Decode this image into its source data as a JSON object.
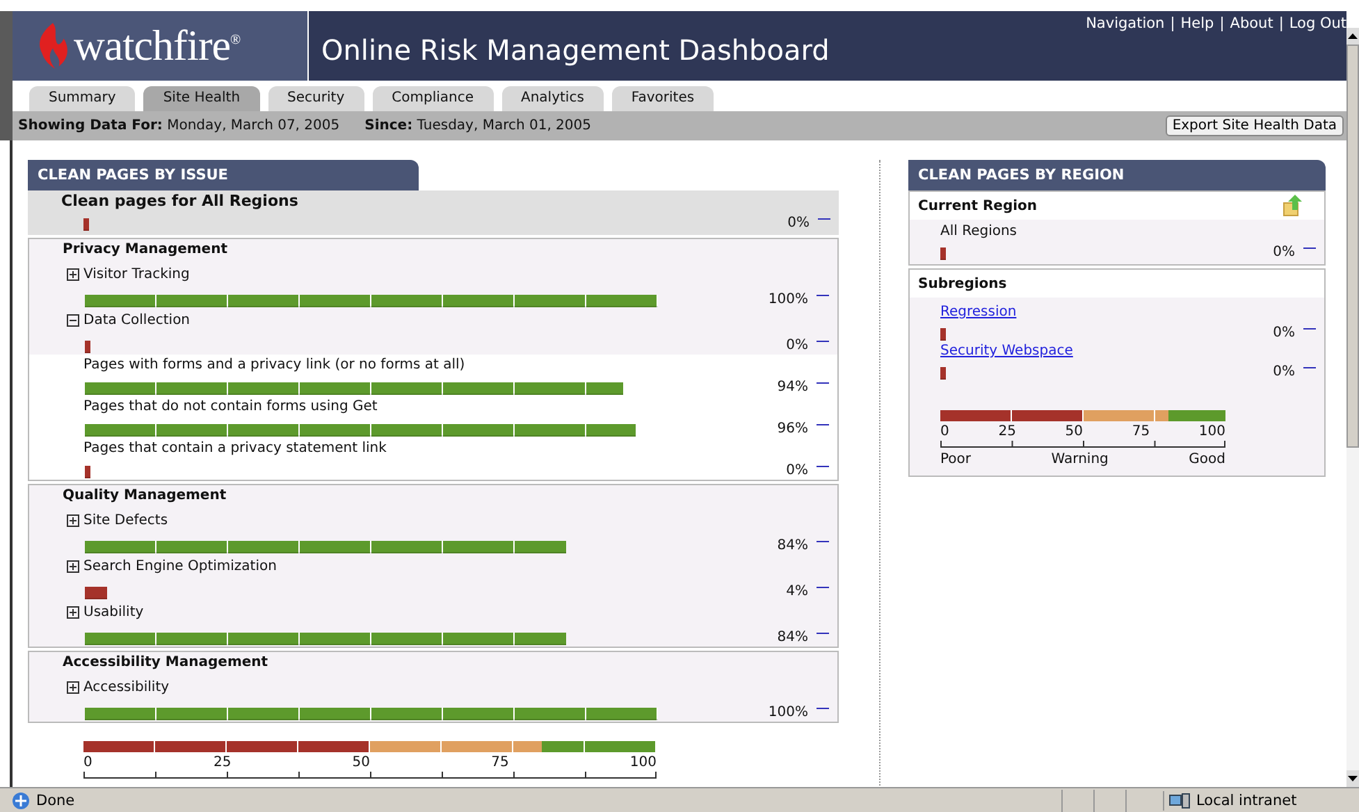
{
  "header": {
    "logo": "watchfire$^{®}$",
    "title": "Online Risk Management Dashboard",
    "links": [
      "Navigation",
      "Help",
      "About",
      "Log Out"
    ],
    "separator": "|"
  },
  "tabs": [
    {
      "label": "Summary",
      "selected": false
    },
    {
      "label": "Site Health",
      "selected": true
    },
    {
      "label": "Security",
      "selected": false
    },
    {
      "label": "Compliance",
      "selected": false
    },
    {
      "label": "Analytics",
      "selected": false
    },
    {
      "label": "Favorites",
      "selected": false
    }
  ],
  "info_bar": {
    "showing_label": "Showing Data For:",
    "showing_value": "Monday, March 07, 2005",
    "since_label": "Since:",
    "since_value": "Tuesday, March 01, 2005",
    "export_button": "Export Site Health Data"
  },
  "issues_panel": {
    "title": "CLEAN PAGES BY ISSUE",
    "summary": {
      "label": "Clean pages for All Regions",
      "value": "0%"
    },
    "groups": [
      {
        "title": "Privacy Management",
        "items": [
          {
            "kind": "item",
            "label": "Visitor Tracking",
            "expanded": false,
            "value": "100%"
          },
          {
            "kind": "item",
            "label": "Data Collection",
            "expanded": true,
            "value": "0%"
          },
          {
            "kind": "sub",
            "label": "Pages with forms and a privacy link (or no forms at all)",
            "value": "94%"
          },
          {
            "kind": "sub",
            "label": "Pages that do not contain forms using Get",
            "value": "96%"
          },
          {
            "kind": "sub",
            "label": "Pages that contain a privacy statement link",
            "value": "0%"
          }
        ]
      },
      {
        "title": "Quality Management",
        "items": [
          {
            "kind": "item",
            "label": "Site Defects",
            "expanded": false,
            "value": "84%"
          },
          {
            "kind": "item",
            "label": "Search Engine Optimization",
            "expanded": false,
            "value": "4%"
          },
          {
            "kind": "item",
            "label": "Usability",
            "expanded": false,
            "value": "84%"
          }
        ]
      },
      {
        "title": "Accessibility Management",
        "items": [
          {
            "kind": "item",
            "label": "Accessibility",
            "expanded": false,
            "value": "100%"
          }
        ]
      }
    ],
    "legend": {
      "ticks": [
        "0",
        "25",
        "50",
        "75",
        "100"
      ]
    }
  },
  "region_panel": {
    "title": "CLEAN PAGES BY REGION",
    "current": {
      "heading": "Current Region",
      "name": "All Regions",
      "value": "0%"
    },
    "subregions": {
      "heading": "Subregions",
      "items": [
        {
          "name": "Regression",
          "value": "0%"
        },
        {
          "name": "Security Webspace",
          "value": "0%"
        }
      ]
    },
    "legend": {
      "ticks": [
        "0",
        "25",
        "50",
        "75",
        "100"
      ],
      "labels": [
        "Poor",
        "Warning",
        "Good"
      ]
    }
  },
  "status_bar": {
    "text": "Done",
    "zone": "Local intranet"
  }
}
